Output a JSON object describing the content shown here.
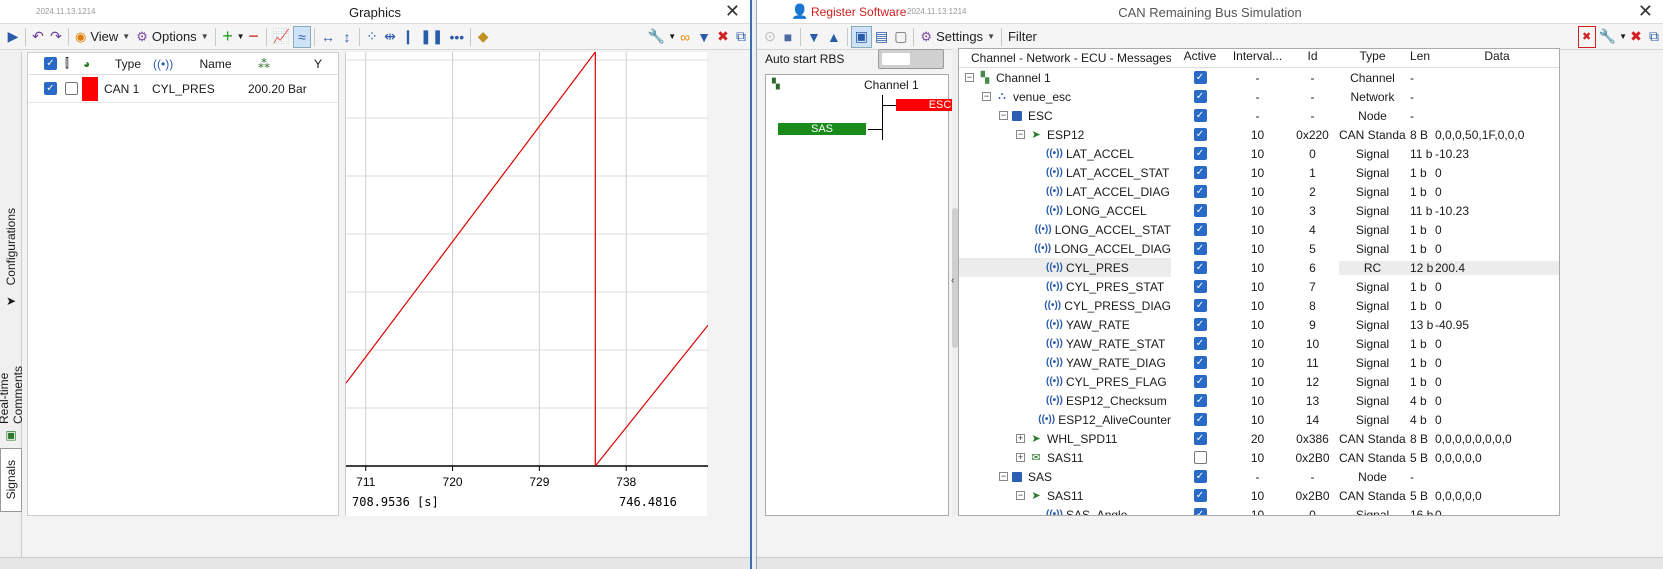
{
  "graphics": {
    "title": "Graphics",
    "version": "2024.11.13.1214",
    "toolbar": {
      "view_label": "View",
      "options_label": "Options"
    },
    "side_tabs": [
      "Configurations",
      "Real-time Comments",
      "Signals"
    ],
    "columns": [
      "Type",
      "Name",
      "Y"
    ],
    "row": {
      "type": "CAN 1",
      "name": "CYL_PRES",
      "y": "200.20 Bar",
      "color": "#ff0000"
    },
    "x_ticks": [
      "711",
      "720",
      "729",
      "738"
    ],
    "time_start": "708.9536 [s]",
    "time_end": "746.4816"
  },
  "chart_data": {
    "type": "line",
    "series": [
      {
        "color": "#e00000",
        "x": [
          708.95,
          734.8
        ],
        "y": [
          0.2,
          1.0
        ]
      },
      {
        "color": "#e00000",
        "x": [
          734.8,
          734.8
        ],
        "y": [
          1.0,
          0.0
        ]
      },
      {
        "color": "#e00000",
        "x": [
          734.8,
          746.48
        ],
        "y": [
          0.0,
          0.34
        ]
      }
    ],
    "xlim": [
      708.9536,
      746.4816
    ],
    "ylim": [
      0,
      1
    ],
    "x_ticks": [
      711,
      720,
      729,
      738
    ],
    "grid": true
  },
  "rbs": {
    "register_label": "Register Software",
    "version": "2024.11.13.1214",
    "title": "CAN Remaining Bus Simulation",
    "settings_label": "Settings",
    "filter_label": "Filter",
    "auto_start_label": "Auto start RBS",
    "auto_start_on": false,
    "topology": {
      "channel": "Channel 1",
      "nodes": [
        {
          "name": "ESC",
          "color": "#ff0000"
        },
        {
          "name": "SAS",
          "color": "#1a8a1a"
        }
      ]
    },
    "columns": [
      "Channel - Network - ECU - Messages",
      "Active",
      "Interval...",
      "Id",
      "Type",
      "Len",
      "Data"
    ],
    "rows": [
      {
        "level": 0,
        "exp": "−",
        "icon": "chan",
        "name": "Channel 1",
        "active": true,
        "interval": "-",
        "id": "-",
        "type": "Channel",
        "len": "-",
        "data": ""
      },
      {
        "level": 1,
        "exp": "−",
        "icon": "net",
        "name": "venue_esc",
        "active": true,
        "interval": "-",
        "id": "-",
        "type": "Network",
        "len": "-",
        "data": ""
      },
      {
        "level": 2,
        "exp": "−",
        "icon": "node",
        "name": "ESC",
        "active": true,
        "interval": "-",
        "id": "-",
        "type": "Node",
        "len": "-",
        "data": ""
      },
      {
        "level": 3,
        "exp": "−",
        "icon": "msg",
        "name": "ESP12",
        "active": true,
        "interval": "10",
        "id": "0x220",
        "type": "CAN Standar",
        "len": "8 B",
        "data": "0,0,0,50,1F,0,0,0"
      },
      {
        "level": 4,
        "icon": "sig",
        "name": "LAT_ACCEL",
        "active": true,
        "interval": "10",
        "id": "0",
        "type": "Signal",
        "len": "11 b",
        "data": "-10.23"
      },
      {
        "level": 4,
        "icon": "sig",
        "name": "LAT_ACCEL_STAT",
        "active": true,
        "interval": "10",
        "id": "1",
        "type": "Signal",
        "len": "1 b",
        "data": "0"
      },
      {
        "level": 4,
        "icon": "sig",
        "name": "LAT_ACCEL_DIAG",
        "active": true,
        "interval": "10",
        "id": "2",
        "type": "Signal",
        "len": "1 b",
        "data": "0"
      },
      {
        "level": 4,
        "icon": "sig",
        "name": "LONG_ACCEL",
        "active": true,
        "interval": "10",
        "id": "3",
        "type": "Signal",
        "len": "11 b",
        "data": "-10.23"
      },
      {
        "level": 4,
        "icon": "sig",
        "name": "LONG_ACCEL_STAT",
        "active": true,
        "interval": "10",
        "id": "4",
        "type": "Signal",
        "len": "1 b",
        "data": "0"
      },
      {
        "level": 4,
        "icon": "sig",
        "name": "LONG_ACCEL_DIAG",
        "active": true,
        "interval": "10",
        "id": "5",
        "type": "Signal",
        "len": "1 b",
        "data": "0"
      },
      {
        "level": 4,
        "icon": "sig",
        "name": "CYL_PRES",
        "active": true,
        "interval": "10",
        "id": "6",
        "type": "RC",
        "len": "12 b",
        "data": "200.4",
        "selected": true
      },
      {
        "level": 4,
        "icon": "sig",
        "name": "CYL_PRES_STAT",
        "active": true,
        "interval": "10",
        "id": "7",
        "type": "Signal",
        "len": "1 b",
        "data": "0"
      },
      {
        "level": 4,
        "icon": "sig",
        "name": "CYL_PRESS_DIAG",
        "active": true,
        "interval": "10",
        "id": "8",
        "type": "Signal",
        "len": "1 b",
        "data": "0"
      },
      {
        "level": 4,
        "icon": "sig",
        "name": "YAW_RATE",
        "active": true,
        "interval": "10",
        "id": "9",
        "type": "Signal",
        "len": "13 b",
        "data": "-40.95"
      },
      {
        "level": 4,
        "icon": "sig",
        "name": "YAW_RATE_STAT",
        "active": true,
        "interval": "10",
        "id": "10",
        "type": "Signal",
        "len": "1 b",
        "data": "0"
      },
      {
        "level": 4,
        "icon": "sig",
        "name": "YAW_RATE_DIAG",
        "active": true,
        "interval": "10",
        "id": "11",
        "type": "Signal",
        "len": "1 b",
        "data": "0"
      },
      {
        "level": 4,
        "icon": "sig",
        "name": "CYL_PRES_FLAG",
        "active": true,
        "interval": "10",
        "id": "12",
        "type": "Signal",
        "len": "1 b",
        "data": "0"
      },
      {
        "level": 4,
        "icon": "sig",
        "name": "ESP12_Checksum",
        "active": true,
        "interval": "10",
        "id": "13",
        "type": "Signal",
        "len": "4 b",
        "data": "0"
      },
      {
        "level": 4,
        "icon": "sig",
        "name": "ESP12_AliveCounter",
        "active": true,
        "interval": "10",
        "id": "14",
        "type": "Signal",
        "len": "4 b",
        "data": "0"
      },
      {
        "level": 3,
        "exp": "+",
        "icon": "msg",
        "name": "WHL_SPD11",
        "active": true,
        "interval": "20",
        "id": "0x386",
        "type": "CAN Standar",
        "len": "8 B",
        "data": "0,0,0,0,0,0,0,0"
      },
      {
        "level": 3,
        "exp": "+",
        "icon": "msg2",
        "name": "SAS11",
        "active": false,
        "interval": "10",
        "id": "0x2B0",
        "type": "CAN Standar",
        "len": "5 B",
        "data": "0,0,0,0,0"
      },
      {
        "level": 2,
        "exp": "−",
        "icon": "node",
        "name": "SAS",
        "active": true,
        "interval": "-",
        "id": "-",
        "type": "Node",
        "len": "-",
        "data": ""
      },
      {
        "level": 3,
        "exp": "−",
        "icon": "msg",
        "name": "SAS11",
        "active": true,
        "interval": "10",
        "id": "0x2B0",
        "type": "CAN Standar",
        "len": "5 B",
        "data": "0,0,0,0,0"
      },
      {
        "level": 4,
        "icon": "sig",
        "name": "SAS_Angle",
        "active": true,
        "interval": "10",
        "id": "0",
        "type": "Signal",
        "len": "16 b",
        "data": "0"
      }
    ]
  }
}
